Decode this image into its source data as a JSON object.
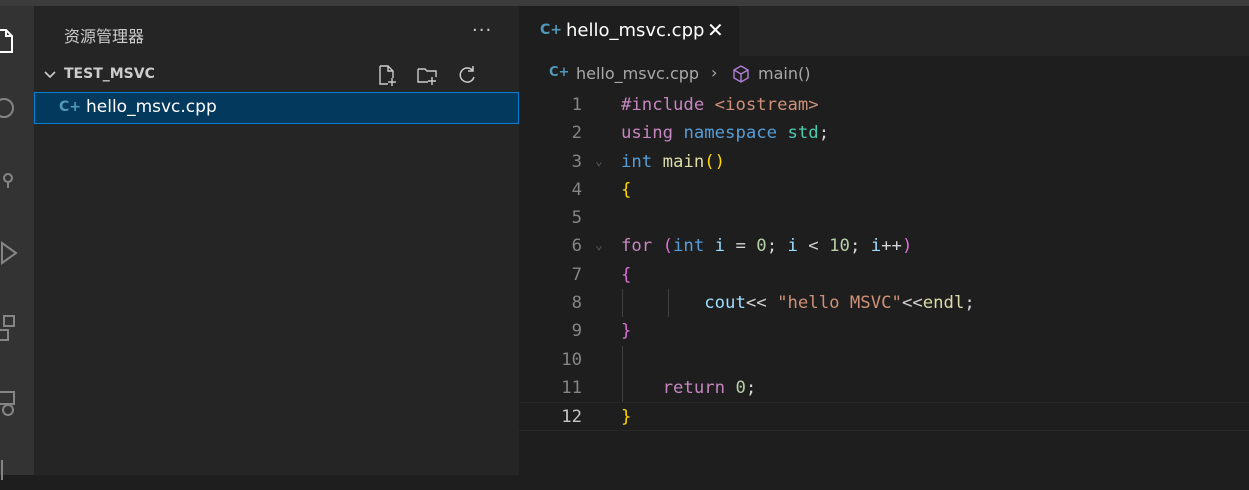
{
  "sidebar": {
    "title": "资源管理器",
    "more": "···",
    "folder": "TEST_MSVC",
    "files": [
      {
        "icon": "C+",
        "name": "hello_msvc.cpp"
      }
    ]
  },
  "tab": {
    "icon": "C+",
    "label": "hello_msvc.cpp",
    "close": "✕"
  },
  "breadcrumb": {
    "icon": "C+",
    "file": "hello_msvc.cpp",
    "sep": "›",
    "symbol": "main()"
  },
  "lines": [
    {
      "n": "1",
      "tokens": [
        [
          "#include ",
          "#c586c0"
        ],
        [
          "<iostream>",
          "#ce9178"
        ]
      ]
    },
    {
      "n": "2",
      "tokens": [
        [
          "using ",
          "#c586c0"
        ],
        [
          "namespace ",
          "#569cd6"
        ],
        [
          "std",
          "#4ec9b0"
        ],
        [
          ";",
          "#d4d4d4"
        ]
      ]
    },
    {
      "n": "3",
      "fold": true,
      "tokens": [
        [
          "int ",
          "#569cd6"
        ],
        [
          "main",
          "#dcdcaa"
        ],
        [
          "()",
          "#ffd700"
        ]
      ]
    },
    {
      "n": "4",
      "tokens": [
        [
          "{",
          "#ffd700"
        ]
      ]
    },
    {
      "n": "5",
      "tokens": []
    },
    {
      "n": "6",
      "fold": true,
      "tokens": [
        [
          "for ",
          "#c586c0"
        ],
        [
          "(",
          "#da70d6"
        ],
        [
          "int ",
          "#569cd6"
        ],
        [
          "i",
          "#9cdcfe"
        ],
        [
          " = ",
          "#d4d4d4"
        ],
        [
          "0",
          "#b5cea8"
        ],
        [
          "; ",
          "#d4d4d4"
        ],
        [
          "i",
          "#9cdcfe"
        ],
        [
          " < ",
          "#d4d4d4"
        ],
        [
          "10",
          "#b5cea8"
        ],
        [
          "; ",
          "#d4d4d4"
        ],
        [
          "i",
          "#9cdcfe"
        ],
        [
          "++",
          "#d4d4d4"
        ],
        [
          ")",
          "#da70d6"
        ]
      ]
    },
    {
      "n": "7",
      "tokens": [
        [
          "{",
          "#da70d6"
        ]
      ]
    },
    {
      "n": "8",
      "guides": 2,
      "tokens": [
        [
          "        cout",
          "#9cdcfe"
        ],
        [
          "<< ",
          "#d4d4d4"
        ],
        [
          "\"hello MSVC\"",
          "#ce9178"
        ],
        [
          "<<",
          "#d4d4d4"
        ],
        [
          "endl",
          "#dcdcaa"
        ],
        [
          ";",
          "#d4d4d4"
        ]
      ]
    },
    {
      "n": "9",
      "tokens": [
        [
          "}",
          "#da70d6"
        ]
      ]
    },
    {
      "n": "10",
      "guides": 1,
      "tokens": []
    },
    {
      "n": "11",
      "guides": 1,
      "tokens": [
        [
          "    return ",
          "#c586c0"
        ],
        [
          "0",
          "#b5cea8"
        ],
        [
          ";",
          "#d4d4d4"
        ]
      ]
    },
    {
      "n": "12",
      "active": true,
      "tokens": [
        [
          "}",
          "#ffd700"
        ]
      ]
    }
  ]
}
